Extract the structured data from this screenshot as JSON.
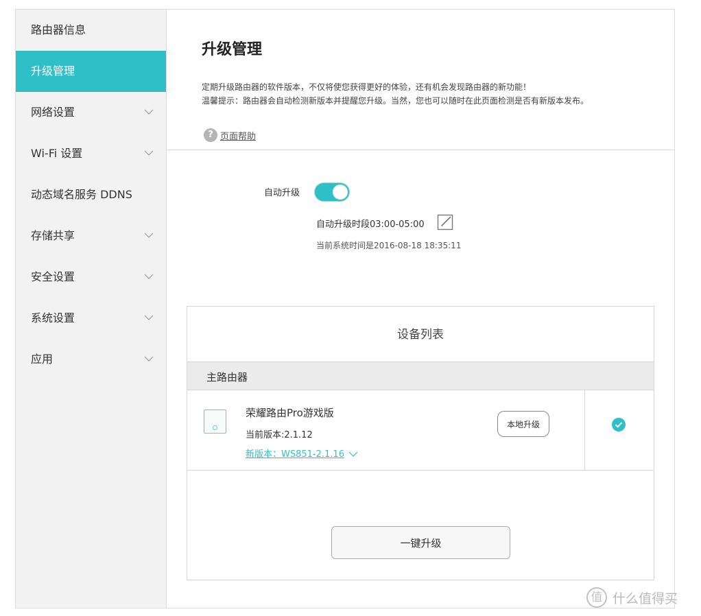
{
  "sidebar": {
    "items": [
      {
        "label": "路由器信息",
        "active": false,
        "expandable": false
      },
      {
        "label": "升级管理",
        "active": true,
        "expandable": false
      },
      {
        "label": "网络设置",
        "active": false,
        "expandable": true
      },
      {
        "label": "Wi-Fi 设置",
        "active": false,
        "expandable": true
      },
      {
        "label": "动态域名服务 DDNS",
        "active": false,
        "expandable": false
      },
      {
        "label": "存储共享",
        "active": false,
        "expandable": true
      },
      {
        "label": "安全设置",
        "active": false,
        "expandable": true
      },
      {
        "label": "系统设置",
        "active": false,
        "expandable": true
      },
      {
        "label": "应用",
        "active": false,
        "expandable": true
      }
    ]
  },
  "main": {
    "title": "升级管理",
    "description_line1": "定期升级路由器的软件版本，不仅将使您获得更好的体验，还有机会发现路由器的新功能！",
    "description_line2": "温馨提示：路由器会自动检测新版本并提醒您升级。当然，您也可以随时在此页面检测是否有新版本发布。",
    "help_icon": "?",
    "help_label": "页面帮助",
    "auto_upgrade": {
      "label": "自动升级",
      "enabled": true,
      "period_label": "自动升级时段03:00-05:00",
      "system_time": "当前系统时间是2016-08-18 18:35:11"
    },
    "device_list": {
      "title": "设备列表",
      "group_label": "主路由器",
      "devices": [
        {
          "name": "荣耀路由Pro游戏版",
          "current_version": "当前版本:2.1.12",
          "new_version": "新版本：WS851-2.1.16",
          "local_upgrade_label": "本地升级",
          "selected": true
        }
      ],
      "one_key_upgrade_label": "一键升级"
    }
  },
  "colors": {
    "accent": "#2ec0c6",
    "sidebar_bg": "#f2f2f2",
    "group_bar_bg": "#ebebeb"
  },
  "watermark": {
    "logo_char": "值",
    "text": "什么值得买"
  }
}
